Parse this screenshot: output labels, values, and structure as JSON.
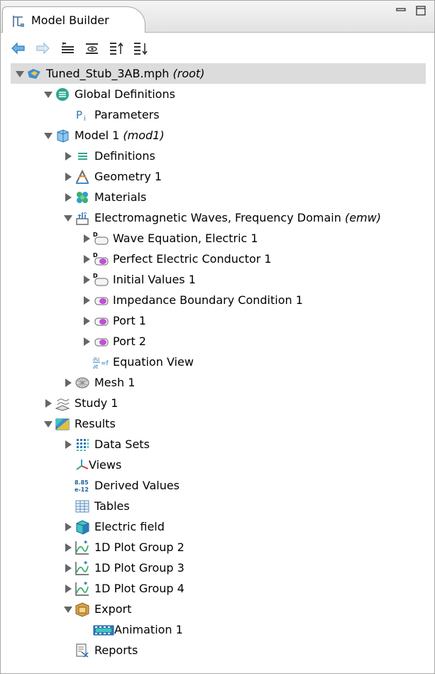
{
  "panel": {
    "tab_title": "Model Builder",
    "tab_icon": "model-builder-icon",
    "window_buttons": [
      "minimize-icon",
      "maximize-icon"
    ]
  },
  "toolbar": {
    "buttons": [
      "back-arrow-icon",
      "forward-arrow-icon",
      "show-icon",
      "collapse-icon",
      "expand-icon",
      "sort-icon"
    ]
  },
  "tree": {
    "root": {
      "label": "Tuned_Stub_3AB.mph",
      "suffix": "(root)",
      "icon": "mph-file-icon"
    },
    "global_definitions": {
      "label": "Global Definitions",
      "icon": "global-definitions-icon"
    },
    "parameters": {
      "label": "Parameters",
      "icon": "parameters-icon"
    },
    "model": {
      "label": "Model 1",
      "suffix": "(mod1)",
      "icon": "model-cube-icon"
    },
    "definitions": {
      "label": "Definitions",
      "icon": "definitions-icon"
    },
    "geometry": {
      "label": "Geometry 1",
      "icon": "geometry-icon"
    },
    "materials": {
      "label": "Materials",
      "icon": "materials-icon"
    },
    "emw": {
      "label": "Electromagnetic Waves, Frequency Domain",
      "suffix": "(emw)",
      "icon": "electromagnetic-waves-icon"
    },
    "wave_equation": {
      "label": "Wave Equation, Electric 1",
      "icon": "domain-node-icon"
    },
    "pec": {
      "label": "Perfect Electric Conductor 1",
      "icon": "boundary-node-icon"
    },
    "initial_values": {
      "label": "Initial Values 1",
      "icon": "domain-node-icon"
    },
    "impedance": {
      "label": "Impedance Boundary Condition 1",
      "icon": "boundary-node-icon"
    },
    "port1": {
      "label": "Port 1",
      "icon": "boundary-node-icon"
    },
    "port2": {
      "label": "Port 2",
      "icon": "boundary-node-icon"
    },
    "equation_view": {
      "label": "Equation View",
      "icon": "equation-view-icon"
    },
    "mesh": {
      "label": "Mesh 1",
      "icon": "mesh-icon"
    },
    "study": {
      "label": "Study 1",
      "icon": "study-icon"
    },
    "results": {
      "label": "Results",
      "icon": "results-icon"
    },
    "data_sets": {
      "label": "Data Sets",
      "icon": "data-sets-icon"
    },
    "views": {
      "label": "Views",
      "icon": "views-axes-icon"
    },
    "derived_values": {
      "label": "Derived Values",
      "icon": "derived-values-icon",
      "icon_text_top": "8.85",
      "icon_text_bottom": "e-12"
    },
    "tables": {
      "label": "Tables",
      "icon": "tables-icon"
    },
    "electric_field": {
      "label": "Electric field",
      "icon": "plot-3d-icon"
    },
    "plot_group2": {
      "label": "1D Plot Group 2",
      "icon": "plot-1d-icon"
    },
    "plot_group3": {
      "label": "1D Plot Group 3",
      "icon": "plot-1d-icon"
    },
    "plot_group4": {
      "label": "1D Plot Group 4",
      "icon": "plot-1d-icon"
    },
    "export": {
      "label": "Export",
      "icon": "export-icon"
    },
    "animation": {
      "label": "Animation 1",
      "icon": "animation-icon"
    },
    "reports": {
      "label": "Reports",
      "icon": "reports-icon"
    }
  }
}
